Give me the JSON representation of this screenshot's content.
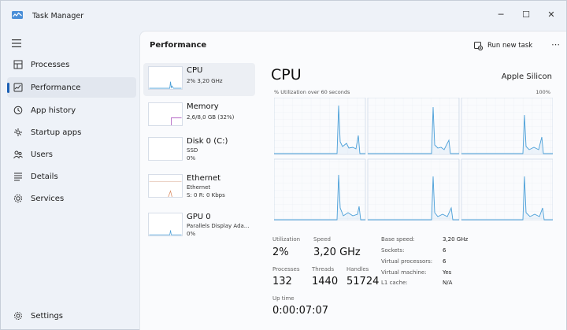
{
  "app": {
    "title": "Task Manager"
  },
  "window_controls": {
    "minimize": "─",
    "maximize": "☐",
    "close": "✕"
  },
  "sidebar": {
    "items": [
      {
        "label": "Processes",
        "icon": "processes-icon"
      },
      {
        "label": "Performance",
        "icon": "performance-icon",
        "active": true
      },
      {
        "label": "App history",
        "icon": "history-icon"
      },
      {
        "label": "Startup apps",
        "icon": "startup-icon"
      },
      {
        "label": "Users",
        "icon": "users-icon"
      },
      {
        "label": "Details",
        "icon": "details-icon"
      },
      {
        "label": "Services",
        "icon": "services-icon"
      }
    ],
    "settings_label": "Settings"
  },
  "main": {
    "title": "Performance",
    "run_task_label": "Run new task",
    "more_label": "⋯"
  },
  "devices": [
    {
      "name": "CPU",
      "sub": [
        "2% 3,20 GHz"
      ]
    },
    {
      "name": "Memory",
      "sub": [
        "2,6/8,0 GB (32%)"
      ]
    },
    {
      "name": "Disk 0 (C:)",
      "sub": [
        "SSD",
        "0%"
      ]
    },
    {
      "name": "Ethernet",
      "sub": [
        "Ethernet",
        "S: 0 R: 0 Kbps"
      ]
    },
    {
      "name": "GPU 0",
      "sub": [
        "Parallels Display Ada...",
        "0%"
      ]
    }
  ],
  "cpu": {
    "title": "CPU",
    "model": "Apple Silicon",
    "graph_caption": "% Utilization over 60 seconds",
    "graph_max": "100%",
    "accent": "#4a9fd8"
  },
  "stats": {
    "utilization": {
      "label": "Utilization",
      "value": "2%"
    },
    "speed": {
      "label": "Speed",
      "value": "3,20 GHz"
    },
    "processes": {
      "label": "Processes",
      "value": "132"
    },
    "threads": {
      "label": "Threads",
      "value": "1440"
    },
    "handles": {
      "label": "Handles",
      "value": "51724"
    },
    "uptime": {
      "label": "Up time",
      "value": "0:00:07:07"
    }
  },
  "specs": [
    {
      "label": "Base speed:",
      "value": "3,20 GHz"
    },
    {
      "label": "Sockets:",
      "value": "6"
    },
    {
      "label": "Virtual processors:",
      "value": "6"
    },
    {
      "label": "Virtual machine:",
      "value": "Yes"
    },
    {
      "label": "L1 cache:",
      "value": "N/A"
    }
  ]
}
